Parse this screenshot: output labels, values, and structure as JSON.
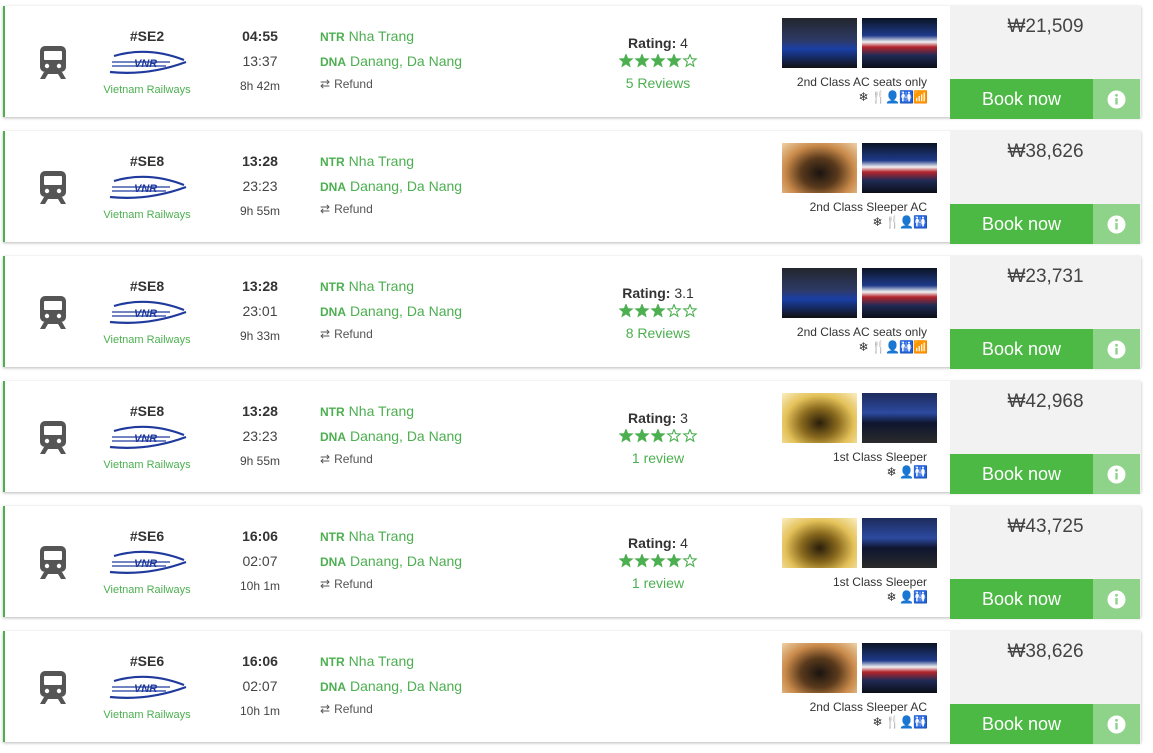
{
  "operator_name": "Vietnam Railways",
  "logo_text": "VNR",
  "colors": {
    "accent": "#4caf50",
    "button": "#4cb944",
    "info_button": "#8fd28a",
    "price_bg": "#f2f2f2",
    "logo": "#1f3a9c"
  },
  "rating_label": "Rating:",
  "book_label": "Book now",
  "refund_label": "Refund",
  "trips": [
    {
      "train": "#SE2",
      "depart": "04:55",
      "arrive": "13:37",
      "duration": "8h 42m",
      "from_code": "NTR",
      "from_name": "Nha Trang",
      "to_code": "DNA",
      "to_name": "Danang, Da Nang",
      "rating": "4",
      "stars": 4,
      "reviews": "5 Reviews",
      "class_name": "2nd Class AC seats only",
      "amenities": [
        "snowflake-icon",
        "fork-knife-icon",
        "person-icon",
        "toilet-icon",
        "wifi-icon"
      ],
      "photos": [
        "seat-car",
        "train-exterior"
      ],
      "price": "₩21,509"
    },
    {
      "train": "#SE8",
      "depart": "13:28",
      "arrive": "23:23",
      "duration": "9h 55m",
      "from_code": "NTR",
      "from_name": "Nha Trang",
      "to_code": "DNA",
      "to_name": "Danang, Da Nang",
      "class_name": "2nd Class Sleeper AC",
      "amenities": [
        "snowflake-icon",
        "fork-knife-icon",
        "person-icon",
        "toilet-icon"
      ],
      "photos": [
        "sleeper-cabin",
        "train-exterior"
      ],
      "price": "₩38,626"
    },
    {
      "train": "#SE8",
      "depart": "13:28",
      "arrive": "23:01",
      "duration": "9h 33m",
      "from_code": "NTR",
      "from_name": "Nha Trang",
      "to_code": "DNA",
      "to_name": "Danang, Da Nang",
      "rating": "3.1",
      "stars": 3,
      "reviews": "8 Reviews",
      "class_name": "2nd Class AC seats only",
      "amenities": [
        "snowflake-icon",
        "fork-knife-icon",
        "person-icon",
        "toilet-icon",
        "wifi-icon"
      ],
      "photos": [
        "seat-car",
        "train-exterior"
      ],
      "price": "₩23,731"
    },
    {
      "train": "#SE8",
      "depart": "13:28",
      "arrive": "23:23",
      "duration": "9h 55m",
      "from_code": "NTR",
      "from_name": "Nha Trang",
      "to_code": "DNA",
      "to_name": "Danang, Da Nang",
      "rating": "3",
      "stars": 3,
      "reviews": "1 review",
      "class_name": "1st Class Sleeper",
      "amenities": [
        "snowflake-icon",
        "person-icon",
        "toilet-icon"
      ],
      "photos": [
        "sleeper-cabin-gold",
        "train-staff"
      ],
      "price": "₩42,968"
    },
    {
      "train": "#SE6",
      "depart": "16:06",
      "arrive": "02:07",
      "duration": "10h 1m",
      "from_code": "NTR",
      "from_name": "Nha Trang",
      "to_code": "DNA",
      "to_name": "Danang, Da Nang",
      "rating": "4",
      "stars": 4,
      "reviews": "1 review",
      "class_name": "1st Class Sleeper",
      "amenities": [
        "snowflake-icon",
        "person-icon",
        "toilet-icon"
      ],
      "photos": [
        "sleeper-cabin-gold",
        "train-staff"
      ],
      "price": "₩43,725"
    },
    {
      "train": "#SE6",
      "depart": "16:06",
      "arrive": "02:07",
      "duration": "10h 1m",
      "from_code": "NTR",
      "from_name": "Nha Trang",
      "to_code": "DNA",
      "to_name": "Danang, Da Nang",
      "class_name": "2nd Class Sleeper AC",
      "amenities": [
        "snowflake-icon",
        "fork-knife-icon",
        "person-icon",
        "toilet-icon"
      ],
      "photos": [
        "sleeper-cabin",
        "train-exterior"
      ],
      "price": "₩38,626"
    }
  ]
}
